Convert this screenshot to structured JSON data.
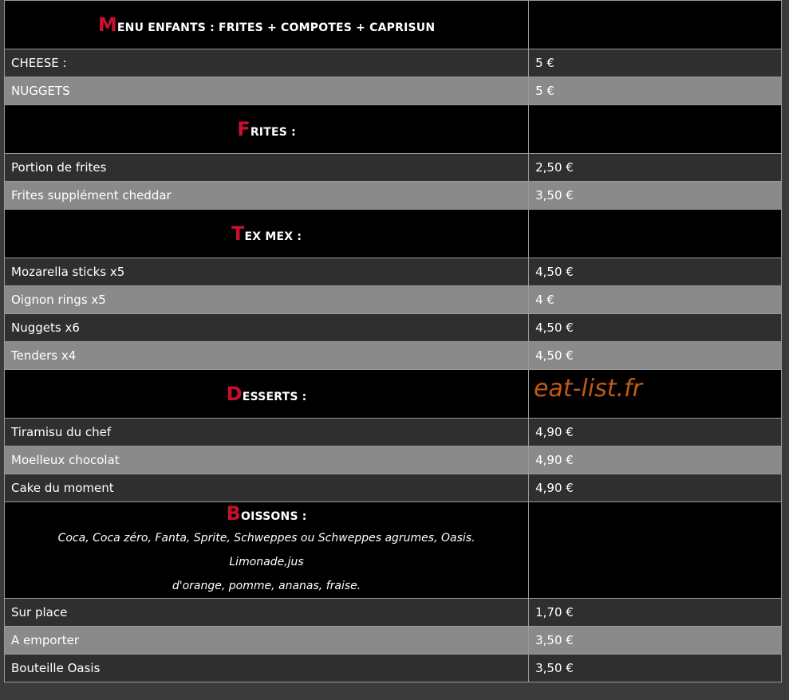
{
  "sections": {
    "enfants": {
      "cap": "M",
      "rest": "ENU ENFANTS : FRITES + COMPOTES + CAPRISUN"
    },
    "frites": {
      "cap": "F",
      "rest": "RITES :"
    },
    "texmex": {
      "cap": "T",
      "rest": "EX MEX :"
    },
    "desserts": {
      "cap": "D",
      "rest": "ESSERTS :"
    },
    "boissons": {
      "cap": "B",
      "rest": "OISSONS :",
      "desc_line1": "Coca, Coca zéro, Fanta, Sprite, Schweppes ou Schweppes agrumes, Oasis. Limonade,jus",
      "desc_line2": "d'orange, pomme, ananas, fraise."
    }
  },
  "items": {
    "enfants": [
      {
        "name": "CHEESE :",
        "price": "5 €"
      },
      {
        "name": "NUGGETS",
        "price": "5 €"
      }
    ],
    "frites": [
      {
        "name": "Portion de frites",
        "price": "2,50 €"
      },
      {
        "name": "Frites supplément cheddar",
        "price": "3,50 €"
      }
    ],
    "texmex": [
      {
        "name": "Mozarella sticks x5",
        "price": "4,50 €"
      },
      {
        "name": "Oignon rings x5",
        "price": "4 €"
      },
      {
        "name": "Nuggets x6",
        "price": "4,50 €"
      },
      {
        "name": "Tenders x4",
        "price": "4,50 €"
      }
    ],
    "desserts": [
      {
        "name": "Tiramisu du chef",
        "price": "4,90 €"
      },
      {
        "name": "Moelleux chocolat",
        "price": "4,90 €"
      },
      {
        "name": "Cake du moment",
        "price": "4,90 €"
      }
    ],
    "boissons": [
      {
        "name": "Sur place",
        "price": "1,70 €"
      },
      {
        "name": "A emporter",
        "price": "3,50 €"
      },
      {
        "name": "Bouteille Oasis",
        "price": "3,50 €"
      }
    ]
  },
  "watermark": "eat-list.fr",
  "colors": {
    "accent": "#c8102e",
    "watermark": "#c15a12",
    "row_dark": "#2f2f2f",
    "row_light": "#8a8a8a"
  }
}
